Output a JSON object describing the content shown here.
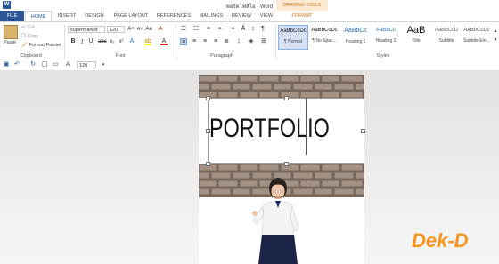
{
  "window": {
    "title": "พอร์ตโฟลิโอ - Word"
  },
  "drawing_tools_label": "DRAWING TOOLS",
  "tabs": [
    "FILE",
    "HOME",
    "INSERT",
    "DESIGN",
    "PAGE LAYOUT",
    "REFERENCES",
    "MAILINGS",
    "REVIEW",
    "VIEW",
    "FORMAT"
  ],
  "clipboard": {
    "paste": "Paste",
    "cut": "Cut",
    "copy": "Copy",
    "format_painter": "Format Painter",
    "label": "Clipboard"
  },
  "font": {
    "name": "supermarket",
    "size": "120",
    "label": "Font"
  },
  "paragraph": {
    "label": "Paragraph"
  },
  "styles": {
    "label": "Styles",
    "items": [
      {
        "sample": "AaBbCcDc",
        "name": "¶ Normal"
      },
      {
        "sample": "AaBbCcDc",
        "name": "¶ No Spac..."
      },
      {
        "sample": "AaBbCc",
        "name": "Heading 1"
      },
      {
        "sample": "AaBbCc",
        "name": "Heading 2"
      },
      {
        "sample": "AaB",
        "name": "Title"
      },
      {
        "sample": "AaBbCcD",
        "name": "Subtitle"
      },
      {
        "sample": "AaBbCcDc",
        "name": "Subtitle Em..."
      }
    ]
  },
  "qat": {
    "font_size": "120"
  },
  "document": {
    "heading": "PORTFOLIO"
  },
  "watermark": "Dek-D",
  "colors": {
    "accent": "#2b579a",
    "drawing_tools": "#d0730d",
    "brick": "#8a7566",
    "logo": "#f7941d"
  }
}
